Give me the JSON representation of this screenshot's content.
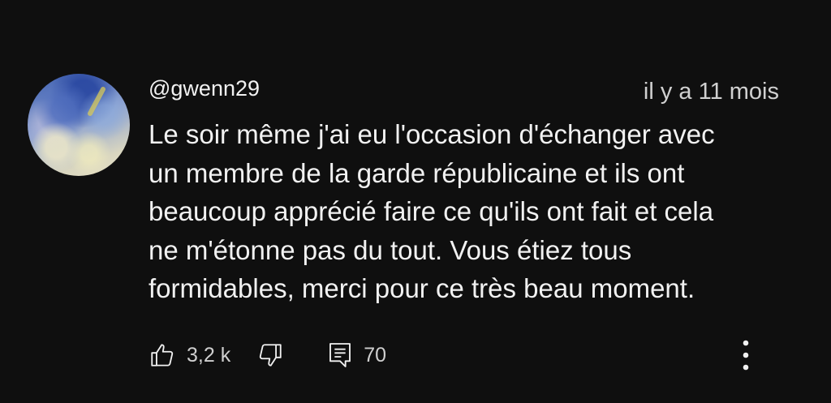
{
  "comment": {
    "author": "@gwenn29",
    "timestamp": "il y a 11 mois",
    "text_lines": [
      "Le soir même j'ai eu l'occasion d'échanger avec",
      "un membre de la garde républicaine et ils ont",
      "beaucoup apprécié faire ce qu'ils ont fait et cela",
      "ne m'étonne pas du tout. Vous étiez tous",
      "formidables, merci pour ce très beau moment."
    ],
    "likes": "3,2 k",
    "replies": "70"
  },
  "icons": {
    "avatar": "avatar-image",
    "like": "thumbs-up-icon",
    "dislike": "thumbs-down-icon",
    "reply": "comment-icon",
    "more": "more-vertical-icon"
  },
  "colors": {
    "background": "#0f0f0f",
    "text_primary": "#f1f1f1",
    "text_secondary": "#cfcfcf"
  }
}
